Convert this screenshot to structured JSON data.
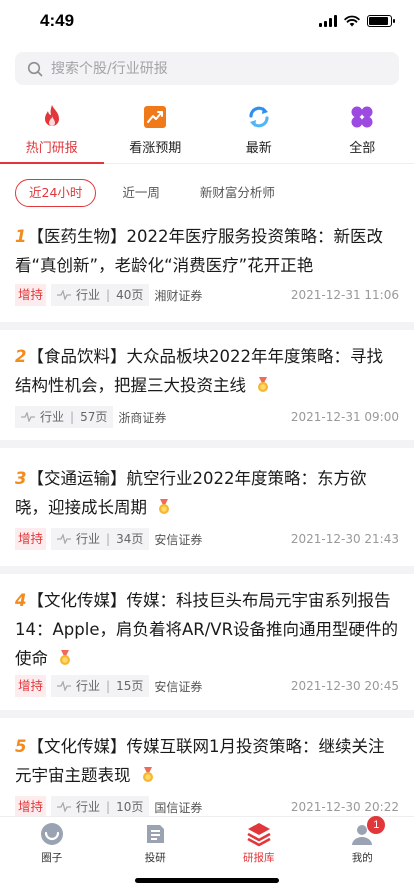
{
  "status": {
    "time": "4:49",
    "battery_level": 0.9
  },
  "search": {
    "placeholder": "搜索个股/行业研报"
  },
  "categories": [
    {
      "label": "热门研报",
      "icon": "fire-icon",
      "active": true
    },
    {
      "label": "看涨预期",
      "icon": "trend-up-icon",
      "active": false
    },
    {
      "label": "最新",
      "icon": "refresh-icon",
      "active": false
    },
    {
      "label": "全部",
      "icon": "grid-clover-icon",
      "active": false
    }
  ],
  "filters": [
    {
      "label": "近24小时",
      "active": true
    },
    {
      "label": "近一周",
      "active": false
    },
    {
      "label": "新财富分析师",
      "active": false
    }
  ],
  "reports": [
    {
      "rank": "1",
      "title": "【医药生物】2022年医疗服务投资策略：新医改看“真创新”，老龄化“消费医疗”花开正艳",
      "has_medal": false,
      "rating": "增持",
      "type": "行业",
      "pages": "40页",
      "broker": "湘财证券",
      "date": "2021-12-31 11:06"
    },
    {
      "rank": "2",
      "title": "【食品饮料】大众品板块2022年年度策略：寻找结构性机会，把握三大投资主线",
      "has_medal": true,
      "rating": "",
      "type": "行业",
      "pages": "57页",
      "broker": "浙商证券",
      "date": "2021-12-31 09:00"
    },
    {
      "rank": "3",
      "title": "【交通运输】航空行业2022年度策略：东方欲晓，迎接成长周期",
      "has_medal": true,
      "rating": "增持",
      "type": "行业",
      "pages": "34页",
      "broker": "安信证券",
      "date": "2021-12-30 21:43"
    },
    {
      "rank": "4",
      "title": "【文化传媒】传媒：科技巨头布局元宇宙系列报告14：Apple，肩负着将AR/VR设备推向通用型硬件的使命",
      "has_medal": true,
      "rating": "增持",
      "type": "行业",
      "pages": "15页",
      "broker": "安信证券",
      "date": "2021-12-30 20:45"
    },
    {
      "rank": "5",
      "title": "【文化传媒】传媒互联网1月投资策略：继续关注元宇宙主题表现",
      "has_medal": true,
      "rating": "增持",
      "type": "行业",
      "pages": "10页",
      "broker": "国信证券",
      "date": "2021-12-30 20:22"
    }
  ],
  "tabbar": [
    {
      "label": "圈子",
      "icon": "circle-face-icon",
      "active": false,
      "badge": ""
    },
    {
      "label": "投研",
      "icon": "document-icon",
      "active": false,
      "badge": ""
    },
    {
      "label": "研报库",
      "icon": "layers-icon",
      "active": true,
      "badge": ""
    },
    {
      "label": "我的",
      "icon": "user-icon",
      "active": false,
      "badge": "1"
    }
  ],
  "colors": {
    "accent": "#e1373b",
    "rank": "#f38b1d",
    "refresh": "#2f8ff0",
    "all": "#9b4be0"
  }
}
